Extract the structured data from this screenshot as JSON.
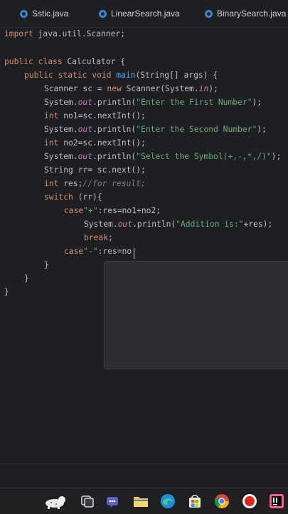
{
  "tabs": [
    {
      "label": "Sstic.java"
    },
    {
      "label": "LinearSearch.java"
    },
    {
      "label": "BinarySearch.java"
    }
  ],
  "code": {
    "l1": {
      "kw": "import",
      "rest": " java.util.Scanner;"
    },
    "l3": {
      "kw": "public class",
      "rest": " Calculator {"
    },
    "l4": {
      "kw": "public static void",
      "fn": "main",
      "rest": "(String[] args) {"
    },
    "l5": {
      "a": "Scanner sc = ",
      "kw": "new",
      "b": " Scanner(System.",
      "it": "in",
      "c": ");"
    },
    "l6": {
      "a": "System.",
      "it": "out",
      "b": ".println(",
      "str": "\"Enter the First Number\"",
      "c": ");"
    },
    "l7": {
      "kw": "int",
      "rest": " no1=sc.nextInt();"
    },
    "l8": {
      "a": "System.",
      "it": "out",
      "b": ".println(",
      "str": "\"Enter the Second Number\"",
      "c": ");"
    },
    "l9": {
      "kw": "int",
      "rest": " no2=sc.nextInt();"
    },
    "l10": {
      "a": "System.",
      "it": "out",
      "b": ".println(",
      "str": "\"Select the Symbol(+,-,*,/)\"",
      "c": ");"
    },
    "l11": {
      "rest": "String rr= sc.next();"
    },
    "l12": {
      "kw": "int",
      "rest": " res;",
      "cm": "//for result;"
    },
    "l13": {
      "kw": "switch",
      "rest": " (rr){"
    },
    "l14": {
      "kw": "case",
      "str": "\"+\"",
      "rest": ":res=no1+no2;"
    },
    "l15": {
      "a": "System.",
      "it": "out",
      "b": ".println(",
      "str": "\"Addition is:\"",
      "c": "+res);"
    },
    "l16": {
      "kw": "break",
      "rest": ";"
    },
    "l17": {
      "kw": "case",
      "str": "\"-\"",
      "rest": ":res=no"
    },
    "l18": {
      "rest": "}"
    },
    "l19": {
      "rest": "}"
    },
    "l20": {
      "rest": "}"
    }
  },
  "taskbar": {
    "icons": [
      "snow-leopard-icon",
      "task-view-icon",
      "teams-icon",
      "file-explorer-icon",
      "edge-icon",
      "store-icon",
      "chrome-icon",
      "record-icon",
      "intellij-icon"
    ]
  },
  "colors": {
    "background": "#1e1f22",
    "keyword": "#cf8e6d",
    "string": "#6aab73",
    "method": "#56a8f5",
    "static_field": "#c77dbb",
    "comment": "#7a7e85",
    "text": "#bcbec4"
  }
}
